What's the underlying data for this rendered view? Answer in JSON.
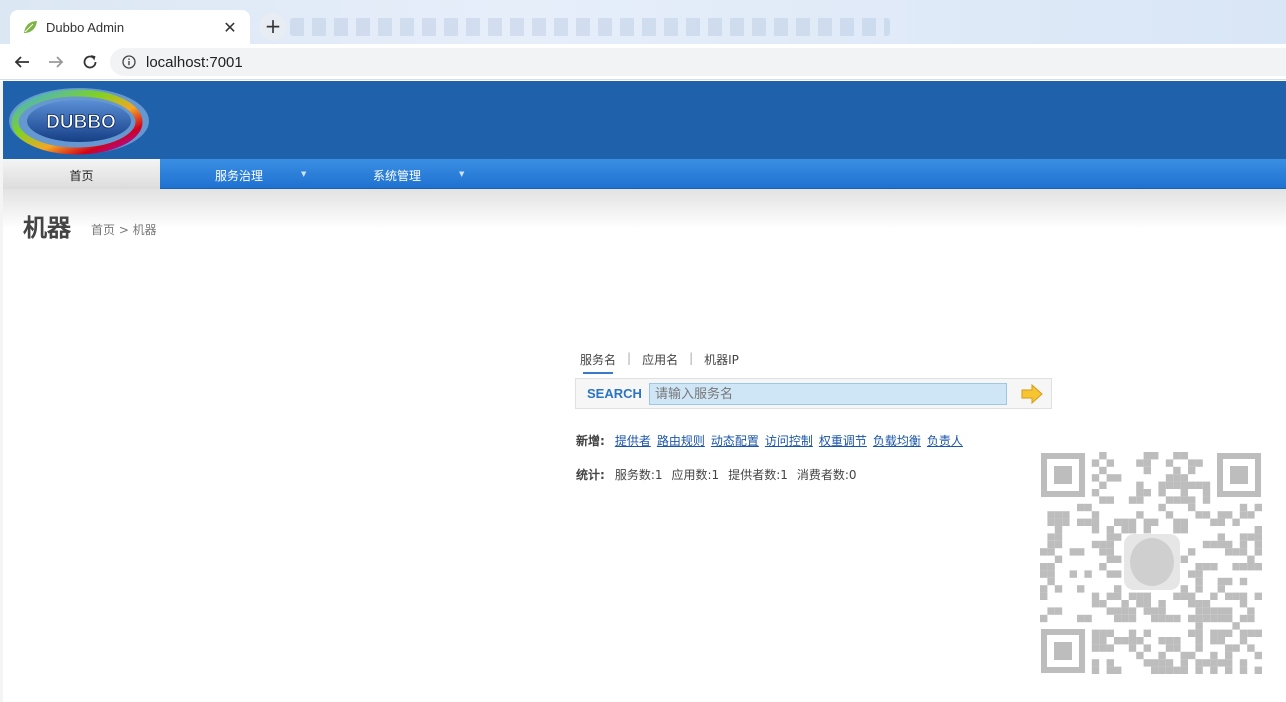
{
  "browser": {
    "tab_title": "Dubbo Admin",
    "close_glyph": "✕",
    "newtab_glyph": "+",
    "url": "localhost:7001"
  },
  "header": {
    "logo_text": "DUBBO"
  },
  "menu": {
    "items": [
      {
        "label": "首页"
      },
      {
        "label": "服务治理"
      },
      {
        "label": "系统管理"
      }
    ],
    "arrow_glyph": "▼"
  },
  "page": {
    "title": "机器",
    "breadcrumb": "首页 > 机器"
  },
  "search": {
    "tabs": [
      "服务名",
      "应用名",
      "机器IP"
    ],
    "separator": "|",
    "label": "SEARCH",
    "placeholder": "请输入服务名"
  },
  "create": {
    "label": "新增:",
    "links": [
      "提供者",
      "路由规则",
      "动态配置",
      "访问控制",
      "权重调节",
      "负载均衡",
      "负责人"
    ]
  },
  "stats": {
    "label": "统计:",
    "items": [
      "服务数:1",
      "应用数:1",
      "提供者数:1",
      "消费者数:0"
    ]
  },
  "colors": {
    "header_blue": "#1f61ab",
    "menu_blue": "#2b7fdb",
    "link_blue": "#1a56a8"
  }
}
